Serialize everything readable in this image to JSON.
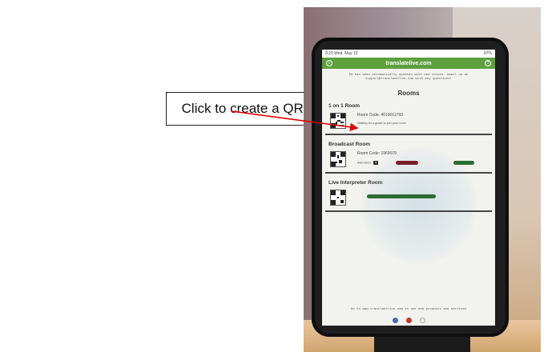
{
  "callout": {
    "text": "Click to create a QR code"
  },
  "colors": {
    "app_bar": "#5e9f3e",
    "arrow": "#e00000"
  },
  "tablet": {
    "status": {
      "time_date": "9:29 Wed, May 15",
      "battery": "87%"
    },
    "app_bar_title": "translatelive.com",
    "notice": "Ed has been automatically updated with new voices. email us at support@translatelive.com with any questions!",
    "rooms_title": "Rooms",
    "sections": {
      "one_on_one": {
        "label": "1 on 1 Room",
        "room_code": "Room Code: 4019011760",
        "status": "Waiting for a guest to join your room"
      },
      "broadcast": {
        "label": "Broadcast Room",
        "room_code": "Room Code: 1969079",
        "attendees_label": "Attendees",
        "attendees_count": "0"
      },
      "interpreter": {
        "label": "Live Interpreter Room"
      }
    },
    "footer": "Go to www.translatelive.com to see new products and services"
  }
}
